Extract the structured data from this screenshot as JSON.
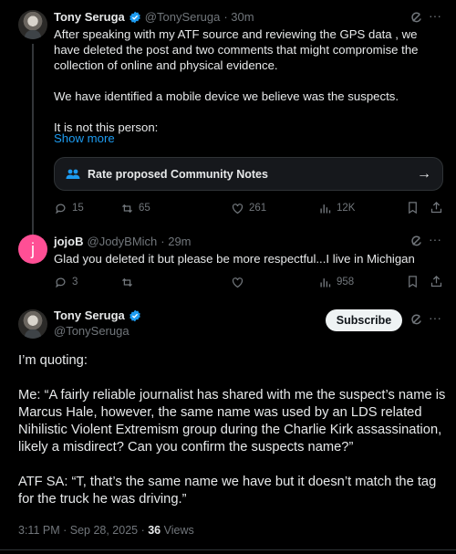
{
  "tweet1": {
    "name": "Tony Seruga",
    "handle": "@TonySeruga",
    "time": "· 30m",
    "paragraphs": [
      "After speaking with my ATF source and reviewing the GPS data , we have deleted the post and two comments that might compromise the collection of online and physical evidence.",
      "We have identified a mobile device we believe was the suspects.",
      "It is not this person:"
    ],
    "show_more": "Show more",
    "community_notes": "Rate proposed Community Notes",
    "stats": {
      "replies": "15",
      "reposts": "65",
      "likes": "261",
      "views": "12K"
    }
  },
  "tweet2": {
    "avatar_letter": "j",
    "name": "jojoB",
    "handle": "@JodyBMich",
    "time": "· 29m",
    "text": "Glad you deleted it but please be more respectful...I live in Michigan",
    "stats": {
      "replies": "3",
      "views": "958"
    }
  },
  "tweet3": {
    "name": "Tony Seruga",
    "handle": "@TonySeruga",
    "subscribe": "Subscribe",
    "paragraphs": [
      "I’m quoting:",
      "Me: “A fairly reliable journalist has shared with me the suspect’s name is Marcus Hale, however, the same name was used by an LDS related Nihilistic Violent Extremism group during the Charlie Kirk assassination, likely a misdirect? Can you confirm the suspects name?”",
      "ATF SA: “T, that’s the same name we have but it doesn’t match the tag for the truck he was driving.”"
    ],
    "timestamp": "3:11 PM · Sep 28, 2025 · ",
    "views_count": "36",
    "views_label": " Views"
  },
  "colors": {
    "accent": "#1d9bf0",
    "background": "#000000",
    "muted": "#71767b"
  }
}
